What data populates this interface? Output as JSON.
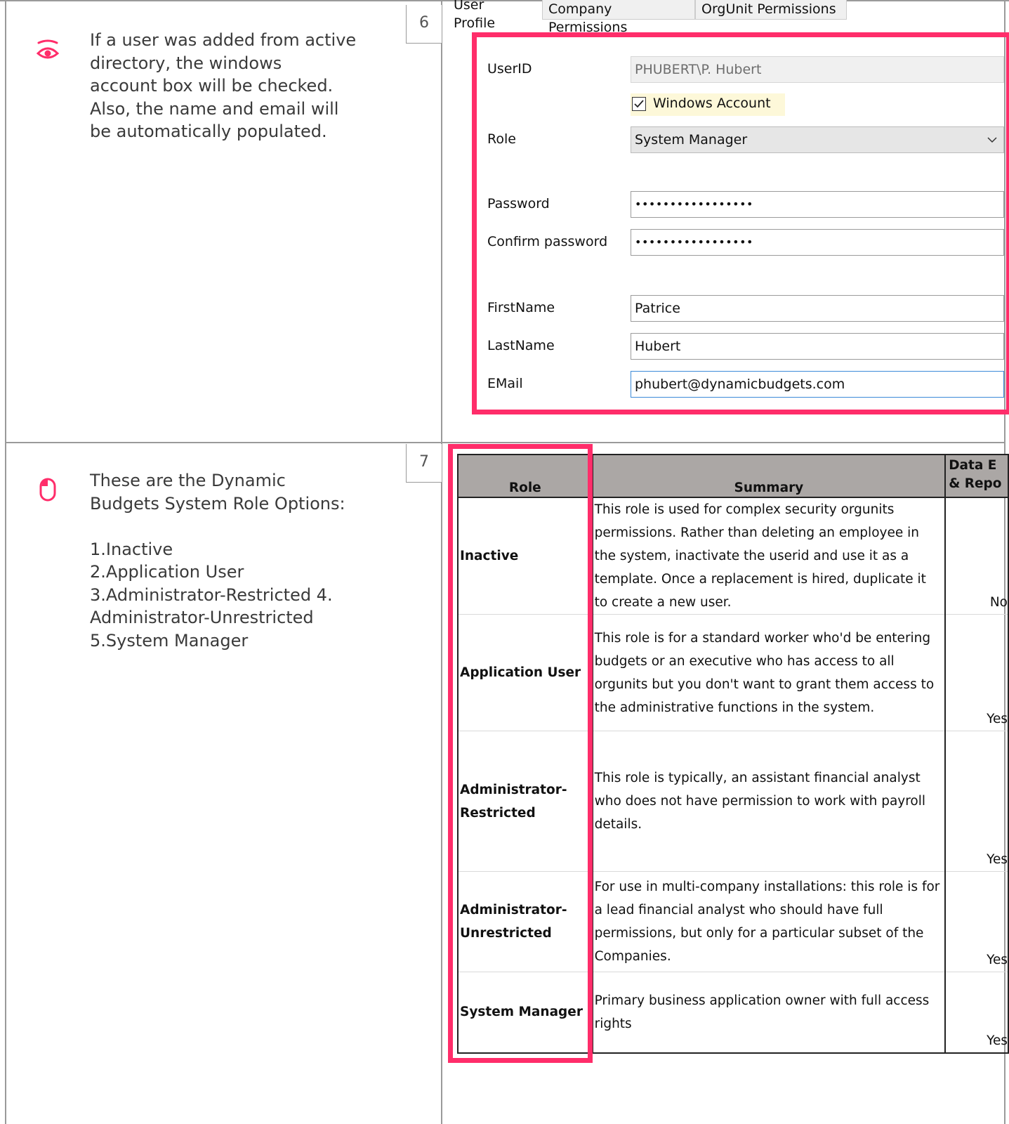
{
  "steps": [
    {
      "number": "6",
      "note": "If a user was added from active\ndirectory, the windows\naccount box will be checked.\nAlso, the name and email will\nbe automatically populated.",
      "icon": "eye-icon"
    },
    {
      "number": "7",
      "note": "These are the Dynamic\nBudgets System Role Options:\n\n1.Inactive\n2.Application User\n3.Administrator-Restricted    4.\nAdministrator-Unrestricted\n5.System Manager",
      "icon": "mouse-icon"
    }
  ],
  "form": {
    "tabs": [
      "User Profile",
      "Company Permissions",
      "OrgUnit Permissions"
    ],
    "userid_label": "UserID",
    "userid_value": "PHUBERT\\P. Hubert",
    "windows_account_label": "Windows Account",
    "role_label": "Role",
    "role_value": "System Manager",
    "password_label": "Password",
    "password_value": "•••••••••••••••••",
    "confirm_label": "Confirm password",
    "confirm_value": "•••••••••••••••••",
    "firstname_label": "FirstName",
    "firstname_value": "Patrice",
    "lastname_label": "LastName",
    "lastname_value": "Hubert",
    "email_label": "EMail",
    "email_value": "phubert@dynamicbudgets.com"
  },
  "roles_table": {
    "headers": [
      "Role",
      "Summary",
      "Data E\n& Repo"
    ],
    "rows": [
      {
        "role": "Inactive",
        "summary": "This role is used for complex security orgunits permissions. Rather than deleting an employee in the system, inactivate the userid and use it as a template. Once a replacement is hired, duplicate it to create a new user.",
        "data": "No"
      },
      {
        "role": "Application User",
        "summary": "This role is for a standard worker who'd be entering budgets or an executive who has access to all orgunits but you don't want to grant them access to the administrative functions in the system.",
        "data": "Yes"
      },
      {
        "role": "Administrator-Restricted",
        "summary": "This role is typically, an assistant financial analyst who does not have permission to work with payroll details.",
        "data": "Yes"
      },
      {
        "role": "Administrator-Unrestricted",
        "summary": "For use in multi-company installations: this role is for a lead financial analyst who should have full permissions, but only for a particular subset of the Companies.",
        "data": "Yes"
      },
      {
        "role": "System Manager",
        "summary": "Primary business application owner with full access rights",
        "data": "Yes"
      }
    ]
  },
  "colors": {
    "accent": "#ff2d6a",
    "border": "#9a9a9a",
    "header_bg": "#aba7a5"
  }
}
